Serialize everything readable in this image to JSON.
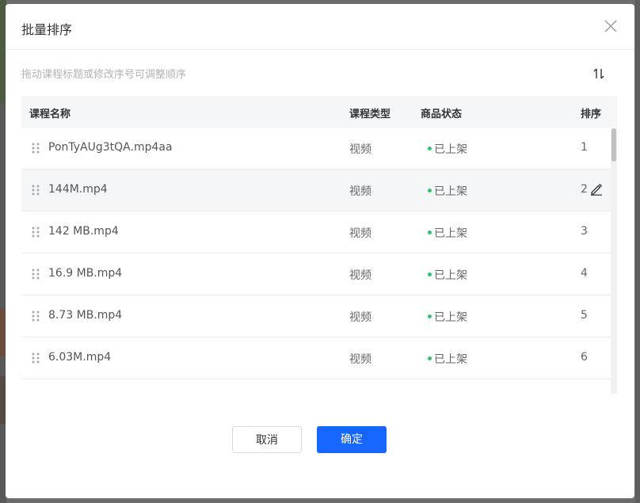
{
  "dialog": {
    "title": "批量排序",
    "hint": "拖动课程标题或修改序号可调整顺序"
  },
  "table": {
    "columns": [
      "课程名称",
      "课程类型",
      "商品状态",
      "排序"
    ],
    "rows": [
      {
        "name": "PonTyAUg3tQA.mp4aa",
        "type": "视频",
        "status": "已上架",
        "order": "1"
      },
      {
        "name": "144M.mp4",
        "type": "视频",
        "status": "已上架",
        "order": "2"
      },
      {
        "name": "142 MB.mp4",
        "type": "视频",
        "status": "已上架",
        "order": "3"
      },
      {
        "name": "16.9 MB.mp4",
        "type": "视频",
        "status": "已上架",
        "order": "4"
      },
      {
        "name": "8.73 MB.mp4",
        "type": "视频",
        "status": "已上架",
        "order": "5"
      },
      {
        "name": "6.03M.mp4",
        "type": "视频",
        "status": "已上架",
        "order": "6"
      }
    ]
  },
  "buttons": {
    "cancel": "取消",
    "confirm": "确定"
  },
  "icons": {
    "close": "close-icon",
    "sort": "sort-toggle-icon",
    "drag": "drag-handle-icon",
    "edit": "pencil-icon"
  },
  "colors": {
    "primary": "#1766ff",
    "status_dot": "#2ec46b",
    "header_bg": "#f5f6f8"
  }
}
